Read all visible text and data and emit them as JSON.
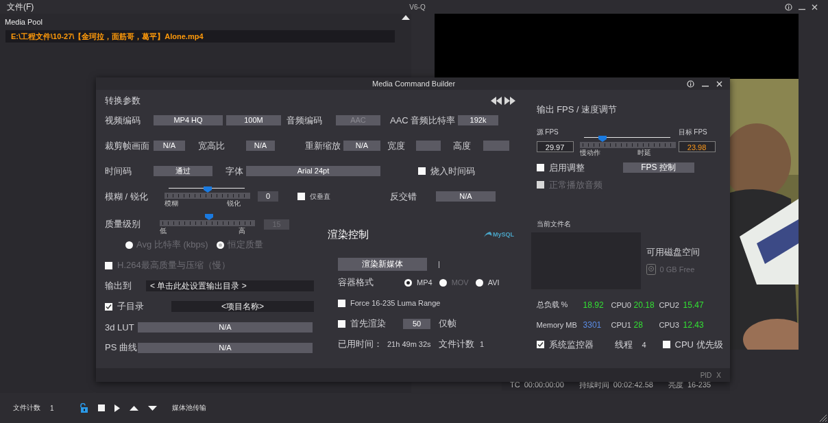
{
  "top_bar": {
    "menu": "文件(F)",
    "title": "V6-Q"
  },
  "media_pool": {
    "title": "Media Pool",
    "items": [
      {
        "path": "E:\\工程文件\\10-27\\【金珂拉，面筋哥，葛平】Alone.mp4",
        "selected": true
      }
    ]
  },
  "viewer": {
    "info": [
      {
        "label": "TC",
        "value": "00:00:00:00"
      },
      {
        "label": "持续时间",
        "value": "00:02:42.58"
      },
      {
        "label": "亮度",
        "value": "16-235"
      }
    ]
  },
  "bottom_bar": {
    "file_count_label": "文件计数",
    "file_count": "1",
    "transfer": "媒体池传输"
  },
  "dialog": {
    "title": "Media Command Builder",
    "convert": {
      "title": "转换参数",
      "video_codec": {
        "label": "视频编码",
        "value": "MP4 HQ",
        "bitrate": "100M"
      },
      "audio_codec": {
        "label": "音频编码",
        "value": "AAC",
        "disabled": true
      },
      "audio_bitrate": {
        "label": "AAC 音频比特率",
        "value": "192k"
      },
      "crop": {
        "label": "裁剪帧画面",
        "value": "N/A"
      },
      "aspect": {
        "label": "宽高比",
        "value": "N/A"
      },
      "rescale": {
        "label": "重新缩放",
        "value": "N/A"
      },
      "width": {
        "label": "宽度"
      },
      "height": {
        "label": "高度"
      },
      "timecode": {
        "label": "时间码",
        "value": "通过"
      },
      "font": {
        "label": "字体",
        "value": "Arial 24pt"
      },
      "burn_timecode": {
        "label": "烧入时间码",
        "checked": false
      },
      "blur": {
        "label": "模糊 / 锐化",
        "level": 0.5,
        "min_label": "模糊",
        "max_label": "锐化",
        "value": "0"
      },
      "vertical_only": {
        "label": "仅垂直",
        "checked": false
      },
      "deinterlace": {
        "label": "反交错",
        "value": "N/A"
      },
      "quality": {
        "label": "质量级别",
        "level": 0.52,
        "min_label": "低",
        "max_label": "高",
        "value": "15",
        "disabled": true
      },
      "rate_modes": [
        {
          "label": "Avg 比特率 (kbps)",
          "selected": false,
          "disabled": true
        },
        {
          "label": "恒定质量",
          "selected": true,
          "disabled": true
        }
      ],
      "h264_best": {
        "label": "H.264最高质量与压缩（慢）",
        "checked": false,
        "disabled": true
      },
      "output": {
        "label": "输出到",
        "value": "< 单击此处设置输出目录 >"
      },
      "subdir": {
        "label": "子目录",
        "checked": true,
        "value": "<项目名称>"
      },
      "lut": {
        "label": "3d LUT",
        "value": "N/A"
      },
      "ps_curve": {
        "label": "PS 曲线",
        "value": "N/A"
      }
    },
    "render": {
      "title": "渲染控制",
      "logo": "MySQL",
      "button": "渲染新媒体",
      "cursor": "|",
      "container_label": "容器格式",
      "containers": [
        {
          "label": "MP4",
          "selected": true,
          "disabled": false
        },
        {
          "label": "MOV",
          "selected": false,
          "disabled": true
        },
        {
          "label": "AVI",
          "selected": false,
          "disabled": false
        }
      ],
      "luma": {
        "label": "Force 16-235 Luma Range",
        "checked": false
      },
      "render_first": {
        "label": "首先渲染",
        "checked": false,
        "value": "50",
        "unit": "仅帧"
      },
      "elapsed_label": "已用时间：",
      "elapsed": "21h 49m 32s",
      "file_count_label": "文件计数",
      "file_count": "1"
    },
    "fps": {
      "title": "输出 FPS / 速度调节",
      "source_label": "源 FPS",
      "target_label": "目标 FPS",
      "source": "29.97",
      "target": "23.98",
      "level": 0.24,
      "min_label": "慢动作",
      "max_label": "时延",
      "enable": {
        "label": "启用调整",
        "checked": false
      },
      "control_button": "FPS 控制",
      "normal_audio": {
        "label": "正常播放音频",
        "checked": false,
        "disabled": true
      }
    },
    "status": {
      "current_file_label": "当前文件名",
      "disk_label": "可用磁盘空间",
      "disk_free": "0 GB Free",
      "stats": [
        {
          "label": "总负载 %",
          "value": "18.92",
          "color": "#33e033"
        },
        {
          "label": "CPU0",
          "value": "20.18",
          "color": "#33e033"
        },
        {
          "label": "CPU2",
          "value": "15.47",
          "color": "#33e033"
        },
        {
          "label": "Memory MB",
          "value": "3301",
          "color": "#5b8de6"
        },
        {
          "label": "CPU1",
          "value": "28",
          "color": "#33e033"
        },
        {
          "label": "CPU3",
          "value": "12.43",
          "color": "#33e033"
        }
      ],
      "monitor": {
        "label": "系统监控器",
        "checked": true
      },
      "threads_label": "线程",
      "threads": "4",
      "cpu_priority": {
        "label": "CPU 优先级",
        "checked": false
      }
    },
    "footer": {
      "label": "PID",
      "close": "X"
    }
  }
}
